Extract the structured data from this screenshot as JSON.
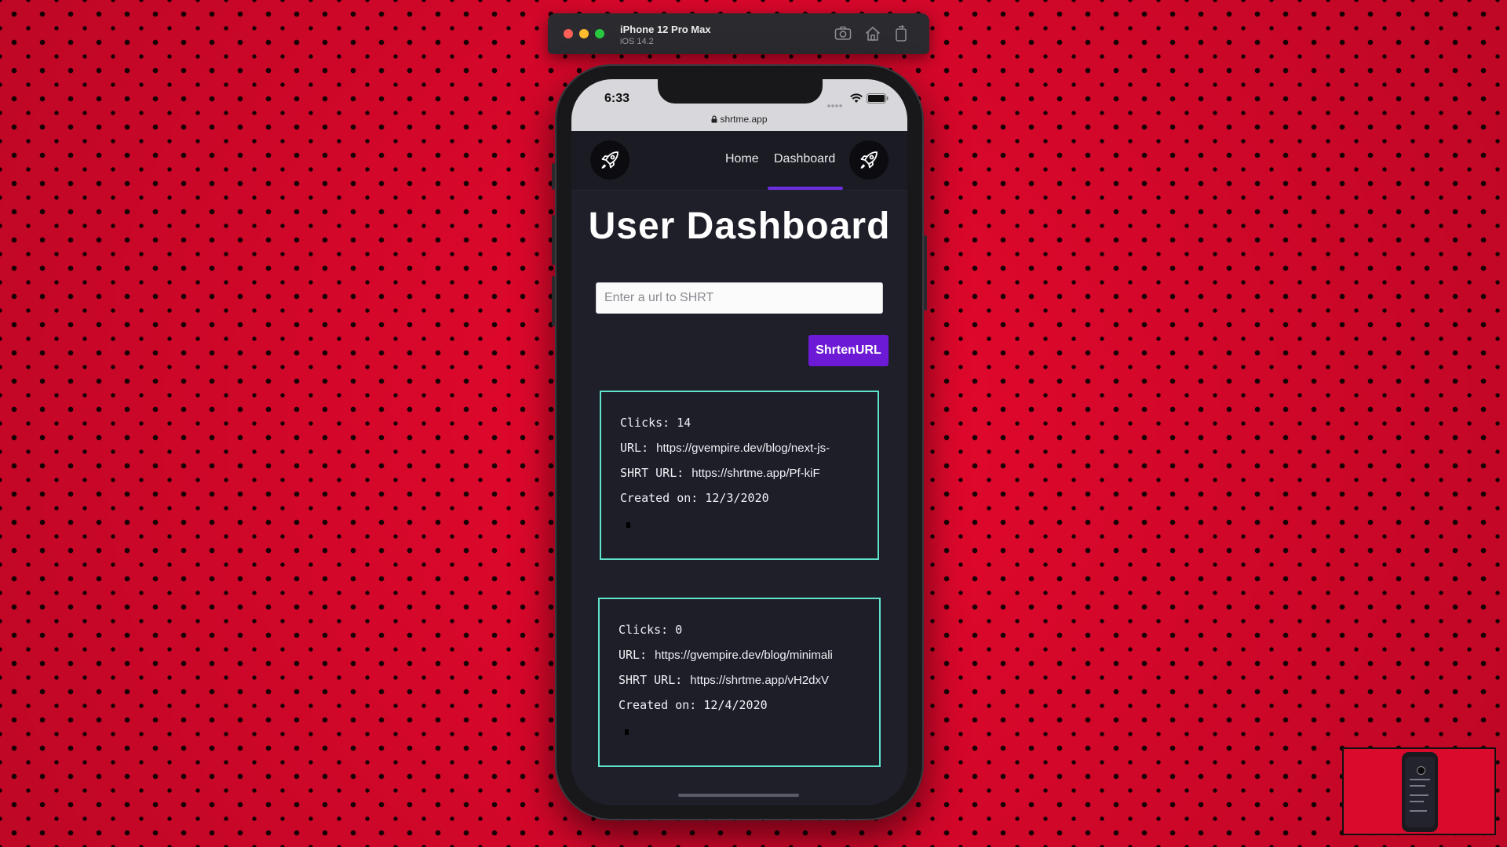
{
  "simulator": {
    "device_name": "iPhone 12 Pro Max",
    "os_version": "iOS 14.2",
    "icons": [
      "screenshot-icon",
      "home-icon",
      "rotate-icon"
    ]
  },
  "status_bar": {
    "time": "6:33",
    "icons": [
      "signal-icon",
      "wifi-icon",
      "battery-icon"
    ]
  },
  "browser": {
    "domain": "shrtme.app",
    "icons": [
      "lock-icon"
    ]
  },
  "nav": {
    "logo_icon": "rocket-icon",
    "links": [
      "Home",
      "Dashboard"
    ],
    "active_link": "Dashboard",
    "profile_icon": "rocket-icon"
  },
  "dashboard": {
    "title": "User Dashboard",
    "input_placeholder": "Enter a url to SHRT",
    "input_value": "",
    "shorten_button": "ShrtenURL"
  },
  "cards": [
    {
      "clicks_label": "Clicks: 14",
      "url_label": "URL:",
      "url": "https://gvempire.dev/blog/next-js-",
      "shrt_label": "SHRT URL:",
      "shrt_url": "https://shrtme.app/Pf-kiF",
      "created": "Created on: 12/3/2020"
    },
    {
      "clicks_label": "Clicks: 0",
      "url_label": "URL:",
      "url": "https://gvempire.dev/blog/minimali",
      "shrt_label": "SHRT URL:",
      "shrt_url": "https://shrtme.app/vH2dxV",
      "created": "Created on: 12/4/2020"
    }
  ],
  "colors": {
    "background": "#e8082e",
    "app_bg": "#1e1f29",
    "accent": "#6d1ad6",
    "card_border": "#5fe3cd"
  }
}
